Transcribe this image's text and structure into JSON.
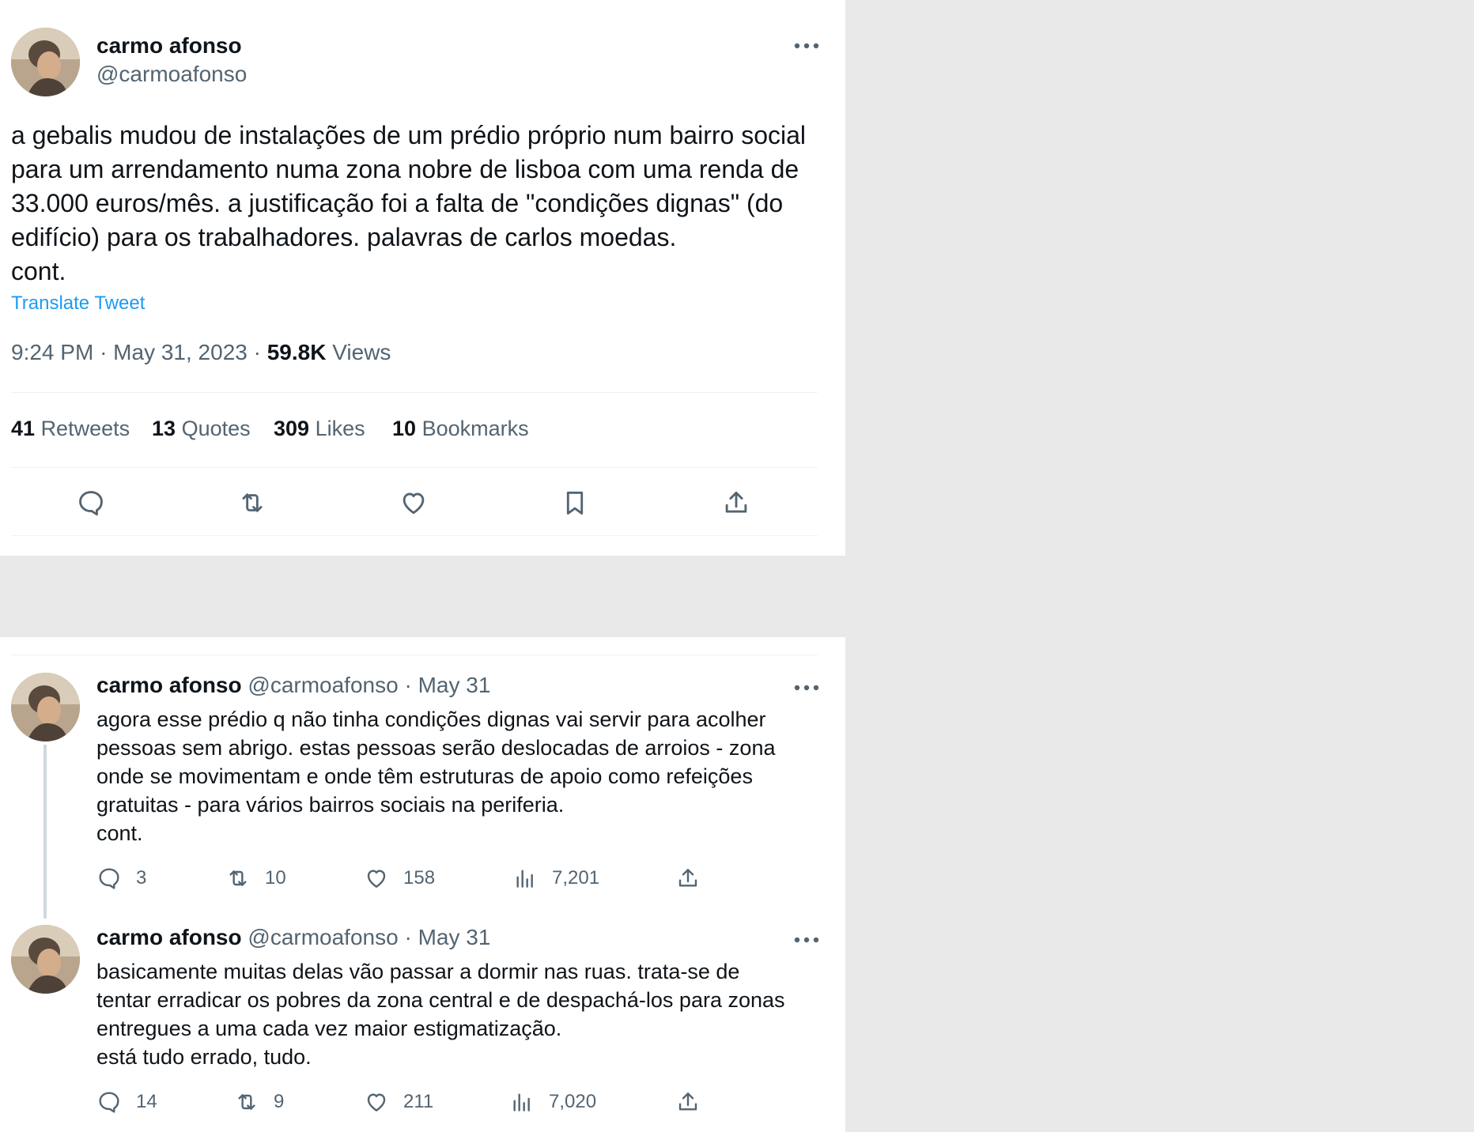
{
  "main_tweet": {
    "author_name": "carmo afonso",
    "author_handle": "@carmoafonso",
    "text": "a gebalis mudou de instalações de um prédio próprio num bairro social\npara um arrendamento numa zona nobre de lisboa com uma renda de\n33.000 euros/mês. a justificação foi a falta de \"condições dignas\" (do\nedifício) para os trabalhadores. palavras de carlos moedas.\ncont.",
    "translate_label": "Translate Tweet",
    "time": "9:24 PM",
    "date": "May 31, 2023",
    "views_count": "59.8K",
    "views_label": "Views",
    "separator": "·",
    "stats": [
      {
        "count": "41",
        "label": "Retweets"
      },
      {
        "count": "13",
        "label": "Quotes"
      },
      {
        "count": "309",
        "label": "Likes"
      },
      {
        "count": "10",
        "label": "Bookmarks"
      }
    ],
    "actions": [
      "reply-icon",
      "retweet-icon",
      "like-icon",
      "bookmark-icon",
      "share-icon"
    ]
  },
  "replies": [
    {
      "author_name": "carmo afonso",
      "author_handle": "@carmoafonso",
      "date": "· May 31",
      "text": "agora esse prédio q não tinha condições dignas vai servir para acolher\npessoas sem abrigo. estas pessoas serão deslocadas de arroios - zona\nonde se movimentam e onde têm estruturas de apoio como refeições\ngratuitas - para vários bairros sociais na periferia.\ncont.",
      "replies": "3",
      "retweets": "10",
      "likes": "158",
      "views": "7,201"
    },
    {
      "author_name": "carmo afonso",
      "author_handle": "@carmoafonso",
      "date": "· May 31",
      "text": "basicamente muitas delas vão passar a dormir nas ruas. trata-se de\ntentar erradicar os pobres da zona central e de despachá-los para zonas\nentregues a uma cada vez maior estigmatização.\nestá tudo errado, tudo.",
      "replies": "14",
      "retweets": "9",
      "likes": "211",
      "views": "7,020"
    }
  ],
  "colors": {
    "text": "#0f1419",
    "secondary": "#536471",
    "link": "#1d9bf0",
    "divider": "#eff3f4",
    "background": "#e9e9e9"
  }
}
